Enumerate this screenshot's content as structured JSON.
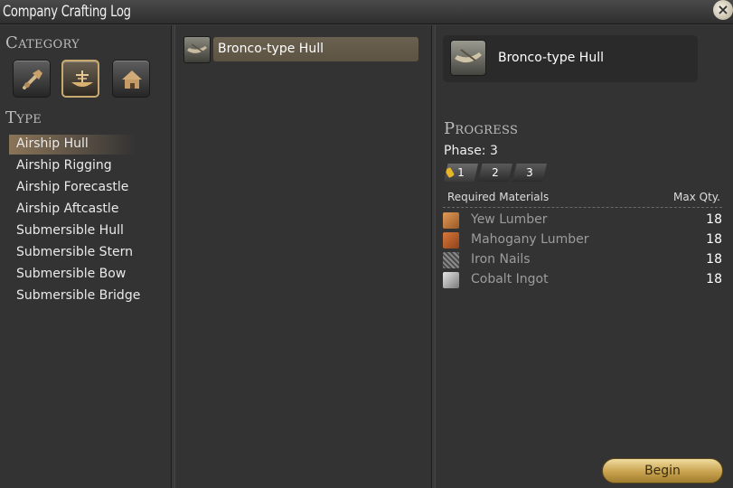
{
  "window": {
    "title": "Company Crafting Log"
  },
  "category": {
    "heading": "Category",
    "buttons": [
      {
        "name": "hammer-icon",
        "selected": false
      },
      {
        "name": "airship-icon",
        "selected": true
      },
      {
        "name": "house-icon",
        "selected": false
      }
    ]
  },
  "type": {
    "heading": "Type",
    "items": [
      "Airship Hull",
      "Airship Rigging",
      "Airship Forecastle",
      "Airship Aftcastle",
      "Submersible Hull",
      "Submersible Stern",
      "Submersible Bow",
      "Submersible Bridge"
    ],
    "selected": "Airship Hull"
  },
  "recipes": [
    {
      "label": "Bronco-type Hull",
      "selected": true
    }
  ],
  "detail": {
    "item_name": "Bronco-type Hull",
    "progress_heading": "Progress",
    "phase_label": "Phase: 3",
    "phases": [
      "1",
      "2",
      "3"
    ],
    "materials_header": {
      "left": "Required Materials",
      "right": "Max Qty."
    },
    "materials": [
      {
        "name": "Yew Lumber",
        "qty": "18",
        "icon": "lumber-icon",
        "color": "#c07838"
      },
      {
        "name": "Mahogany Lumber",
        "qty": "18",
        "icon": "lumber-icon",
        "color": "#b8602c"
      },
      {
        "name": "Iron Nails",
        "qty": "18",
        "icon": "nails-icon",
        "color": "#6e6e6e"
      },
      {
        "name": "Cobalt Ingot",
        "qty": "18",
        "icon": "ingot-icon",
        "color": "#b4b4b4"
      }
    ]
  },
  "actions": {
    "begin_label": "Begin"
  },
  "colors": {
    "accent_gold": "#c8a24e",
    "highlight": "#6b6150"
  }
}
